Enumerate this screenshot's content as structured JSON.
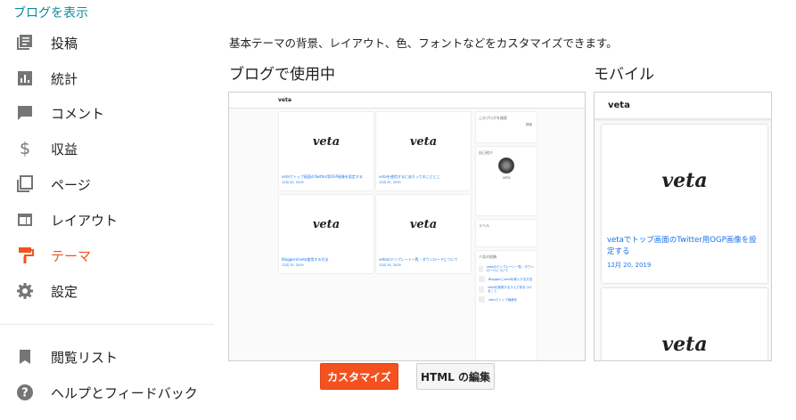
{
  "view_blog_link": "ブログを表示",
  "sidebar": {
    "items": [
      {
        "label": "投稿",
        "icon": "posts-icon"
      },
      {
        "label": "統計",
        "icon": "stats-icon"
      },
      {
        "label": "コメント",
        "icon": "comment-icon"
      },
      {
        "label": "収益",
        "icon": "dollar-icon"
      },
      {
        "label": "ページ",
        "icon": "pages-icon"
      },
      {
        "label": "レイアウト",
        "icon": "layout-icon"
      },
      {
        "label": "テーマ",
        "icon": "paint-roller-icon"
      },
      {
        "label": "設定",
        "icon": "gear-icon"
      }
    ],
    "bottom_items": [
      {
        "label": "閲覧リスト",
        "icon": "bookmark-icon"
      },
      {
        "label": "ヘルプとフィードバック",
        "icon": "help-icon"
      }
    ],
    "accent_color": "#f4511e"
  },
  "main": {
    "description": "基本テーマの背景、レイアウト、色、フォントなどをカスタマイズできます。",
    "desktop_title": "ブログで使用中",
    "mobile_title": "モバイル"
  },
  "preview": {
    "blog_name": "veta",
    "desktop_cards": [
      {
        "title": "vetaでトップ画面のTwitter用OGP画像を設定する",
        "date": "12月 20, 2019"
      },
      {
        "title": "vetaを使用するにあたってのこととこ",
        "date": "12月 20, 2019"
      },
      {
        "title": "Bloggerのveta使用する方法",
        "date": "12月 20, 2019"
      },
      {
        "title": "vetaのテンプレート一覧・ダウンロードについて",
        "date": "12月 20, 2019"
      }
    ],
    "widgets": {
      "search_title": "このブログを検索",
      "search_button": "検索",
      "profile_title": "自己紹介",
      "profile_name": "veta",
      "labels_title": "ラベル",
      "popular_title": "人気の投稿",
      "popular_posts": [
        "vetaのテンプレート一覧・ダウンロードについて",
        "Bloggerにvetaを導入する方法",
        "vetaを使用するうえで気をつけること",
        "vetaでトップ画面を"
      ]
    },
    "mobile_card": {
      "title": "vetaでトップ画面のTwitter用OGP画像を設定する",
      "date": "12月 20, 2019"
    }
  },
  "buttons": {
    "customize": "カスタマイズ",
    "edit_html": "HTML の編集"
  }
}
